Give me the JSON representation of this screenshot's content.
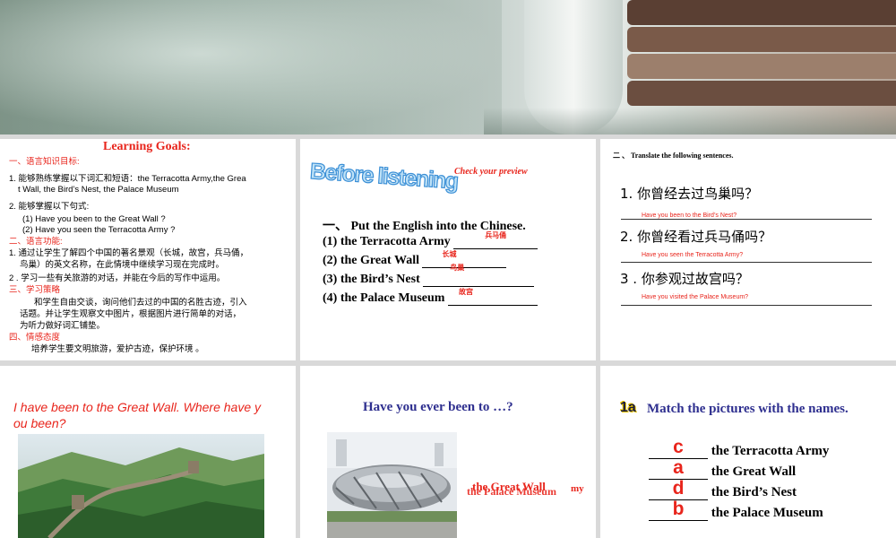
{
  "panel1": {
    "title": "Learning Goals:",
    "sec1": "一、语言知识目标:",
    "i1a": "1. 能够熟练掌握以下词汇和短语：the Terracotta Army,the Grea",
    "i1b": "t Wall, the Bird’s Nest, the Palace Museum",
    "i2": "2.  能够掌握以下句式:",
    "i2a": "(1) Have you been to the Great Wall ?",
    "i2b": "(2) Have you seen the Terracotta Army ?",
    "sec2": "二、语言功能:",
    "f1a": "1. 通过让学生了解四个中国的著名景观（长城，故宫，兵马俑，",
    "f1b": "鸟巢）的英文名称，在此情境中继续学习现在完成时。",
    "f2": "2 . 学习一些有关旅游的对话，并能在今后的写作中运用。",
    "sec3": "三、学习策略",
    "s1a": "和学生自由交谈，询问他们去过的中国的名胜古迹，引入",
    "s1b": "话题。并让学生观察文中图片，根据图片进行简单的对话，",
    "s1c": "为听力做好词汇铺垫。",
    "sec4": "四、情感态度",
    "e1": "培养学生要文明旅游，爱护古迹，保护环境 。"
  },
  "panel2": {
    "heading": "Before listening",
    "preview": "Check your preview",
    "instruction": "一、 Put the English into the Chinese.",
    "items": [
      {
        "text": "(1) the Terracotta Army",
        "answer": "兵马俑"
      },
      {
        "text": "(2) the Great Wall",
        "answer": "长城"
      },
      {
        "text": "(3) the Bird’s Nest",
        "answer": "鸟巢"
      },
      {
        "text": "(4) the Palace Museum",
        "answer": "故宫"
      }
    ]
  },
  "panel3": {
    "title": "二 、 Translate the following sentences.",
    "items": [
      {
        "q": "1.  你曾经去过鸟巢吗？",
        "a": "Have you been to the Bird’s Nest?"
      },
      {
        "q": "2.  你曾经看过兵马俑吗？",
        "a": "Have you seen the Terracotta Army?"
      },
      {
        "q": "3 . 你参观过故宫吗？",
        "a": "Have you visited the Palace Museum?"
      }
    ]
  },
  "panel4": {
    "line1": "I have been to the Great Wall. Where have y",
    "line2": "ou been?"
  },
  "panel5": {
    "question": "Have you ever been to …?",
    "overlap_top": "the Great Wall",
    "overlap_bottom": "the Palace Museum",
    "overlap_tail": "my"
  },
  "panel6": {
    "badge": "1a",
    "instruction": "Match the pictures with the names.",
    "items": [
      {
        "letter": "c",
        "name": "the Terracotta Army"
      },
      {
        "letter": "a",
        "name": "the Great Wall"
      },
      {
        "letter": "d",
        "name": "the Bird’s Nest"
      },
      {
        "letter": "b",
        "name": "the Palace Museum"
      }
    ]
  },
  "colors": {
    "red": "#e8251c",
    "navy": "#2e2f8f",
    "blue_heading": "#3b8fd6"
  }
}
